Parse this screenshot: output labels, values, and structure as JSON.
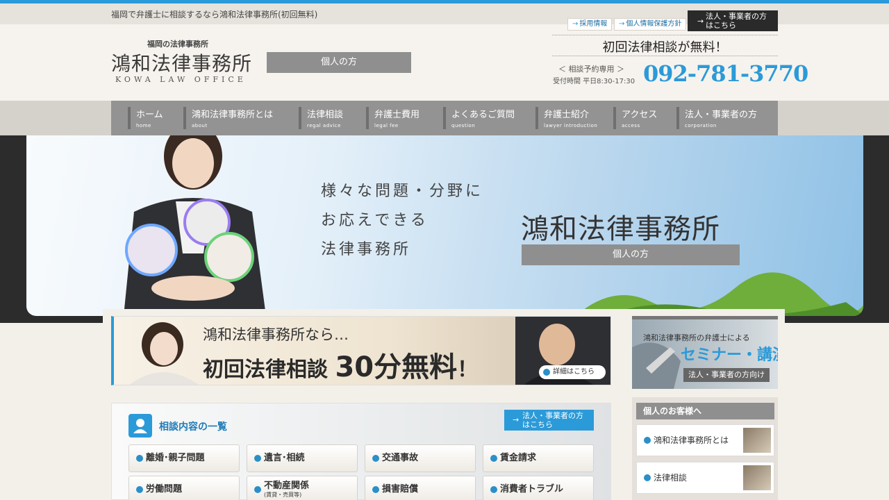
{
  "top": {
    "tagline": "福岡で弁護士に相談するなら鴻和法律事務所(初回無料)",
    "links": [
      {
        "label": "採用情報"
      },
      {
        "label": "個人情報保護方針"
      }
    ],
    "corporate_line1": "法人・事業者の方",
    "corporate_line2": "はこちら"
  },
  "header": {
    "logo_sub": "福岡の法律事務所",
    "logo_main": "鴻和法律事務所",
    "logo_en": "KOWA LAW OFFICE",
    "badge": "個人の方",
    "free_consult": "初回法律相談が無料！",
    "reservation": "相談予約専用",
    "hours": "受付時間 平日8:30-17:30",
    "phone": "092-781-3770"
  },
  "nav": [
    {
      "jp": "ホーム",
      "en": "home"
    },
    {
      "jp": "鴻和法律事務所とは",
      "en": "about"
    },
    {
      "jp": "法律相談",
      "en": "regal advice"
    },
    {
      "jp": "弁護士費用",
      "en": "legal fee"
    },
    {
      "jp": "よくあるご質問",
      "en": "question"
    },
    {
      "jp": "弁護士紹介",
      "en": "lawyer introduction"
    },
    {
      "jp": "アクセス",
      "en": "access"
    },
    {
      "jp": "法人・事業者の方",
      "en": "corporation"
    }
  ],
  "hero": {
    "copy": [
      "様々な問題・分野に",
      "お応えできる",
      "法律事務所"
    ],
    "title": "鴻和法律事務所",
    "badge": "個人の方"
  },
  "banner": {
    "line1": "鴻和法律事務所なら…",
    "line2_pre": "初回法律相談 ",
    "line2_big": "30分無料",
    "line2_post": "！",
    "detail_btn": "詳細はこちら"
  },
  "consult": {
    "title": "相談内容の一覧",
    "corporate_line1": "法人・事業者の方",
    "corporate_line2": "はこちら",
    "items": [
      {
        "label": "離婚･親子問題"
      },
      {
        "label": "遺言･相続"
      },
      {
        "label": "交通事故"
      },
      {
        "label": "賃金請求"
      },
      {
        "label": "労働問題"
      },
      {
        "label": "不動産関係",
        "sub": "(賃貸・売買等)"
      },
      {
        "label": "損害賠償"
      },
      {
        "label": "消費者トラブル"
      }
    ]
  },
  "sidebar": {
    "seminar_line1": "鴻和法律事務所の弁護士による",
    "seminar_line2": "セミナー・講演",
    "seminar_line3": "法人・事業者の方向け",
    "heading": "個人のお客様へ",
    "items": [
      {
        "label": "鴻和法律事務所とは"
      },
      {
        "label": "法律相談"
      }
    ]
  },
  "colors": {
    "accent": "#2b9ad8",
    "nav_bg": "#939393",
    "badge_bg": "#8f8f8f",
    "dark_button": "#2a2a2a"
  }
}
